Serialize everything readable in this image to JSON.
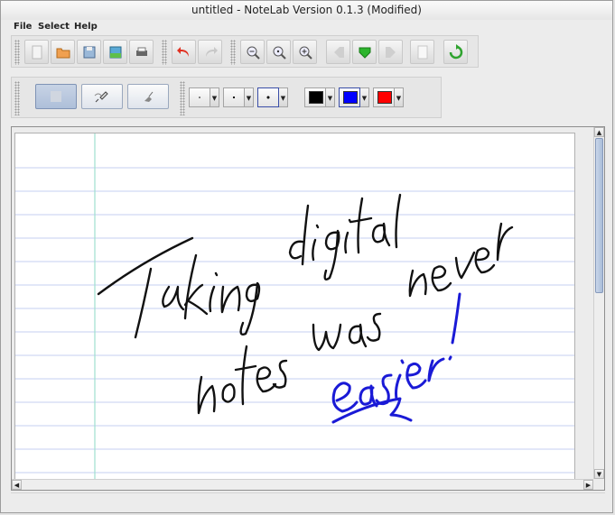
{
  "window": {
    "title": "untitled  -  NoteLab Version 0.1.3  (Modified)"
  },
  "menu": {
    "items": [
      "File",
      "Select",
      "Help"
    ]
  },
  "toolbar": {
    "file_buttons": [
      "new-page-icon",
      "open-folder-icon",
      "save-icon",
      "export-image-icon",
      "print-icon"
    ],
    "edit_buttons": [
      "undo-icon",
      "redo-icon"
    ],
    "zoom_buttons": [
      "zoom-out-icon",
      "zoom-reset-icon",
      "zoom-in-icon"
    ],
    "page_buttons": [
      "previous-page-icon",
      "current-page-icon",
      "next-page-icon",
      "blank-page-icon",
      "refresh-icon"
    ],
    "modes": [
      "select-mode-icon",
      "pen-mode-icon",
      "eraser-mode-icon"
    ],
    "pen_sizes": [
      "small-dot-icon",
      "medium-dot-icon",
      "large-dot-icon"
    ],
    "pen_colors": {
      "black": "#000000",
      "blue": "#0000ff",
      "red": "#ff0000"
    }
  },
  "note": {
    "handwriting_line1": "Taking digital",
    "handwriting_line2": "notes was never",
    "handwriting_line3": "easier!",
    "ink_black": "#111111",
    "ink_blue": "#1a1ad6",
    "rule_color": "#c4cff0",
    "margin_color": "#9fe0cf"
  }
}
